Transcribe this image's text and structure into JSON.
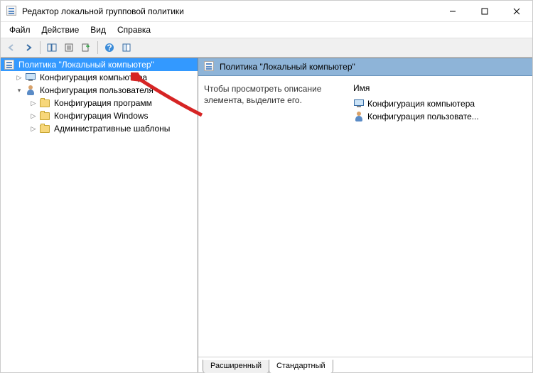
{
  "window": {
    "title": "Редактор локальной групповой политики"
  },
  "menu": {
    "file": "Файл",
    "action": "Действие",
    "view": "Вид",
    "help": "Справка"
  },
  "tree": {
    "root": "Политика \"Локальный компьютер\"",
    "computer_config": "Конфигурация компьютера",
    "user_config": "Конфигурация пользователя",
    "software_config": "Конфигурация программ",
    "windows_config": "Конфигурация Windows",
    "admin_templates": "Административные шаблоны"
  },
  "main": {
    "header_title": "Политика \"Локальный компьютер\"",
    "description": "Чтобы просмотреть описание элемента, выделите его.",
    "list_header": "Имя",
    "items": [
      {
        "label": "Конфигурация компьютера",
        "icon": "computer"
      },
      {
        "label": "Конфигурация пользовате...",
        "icon": "user"
      }
    ]
  },
  "tabs": {
    "extended": "Расширенный",
    "standard": "Стандартный"
  }
}
